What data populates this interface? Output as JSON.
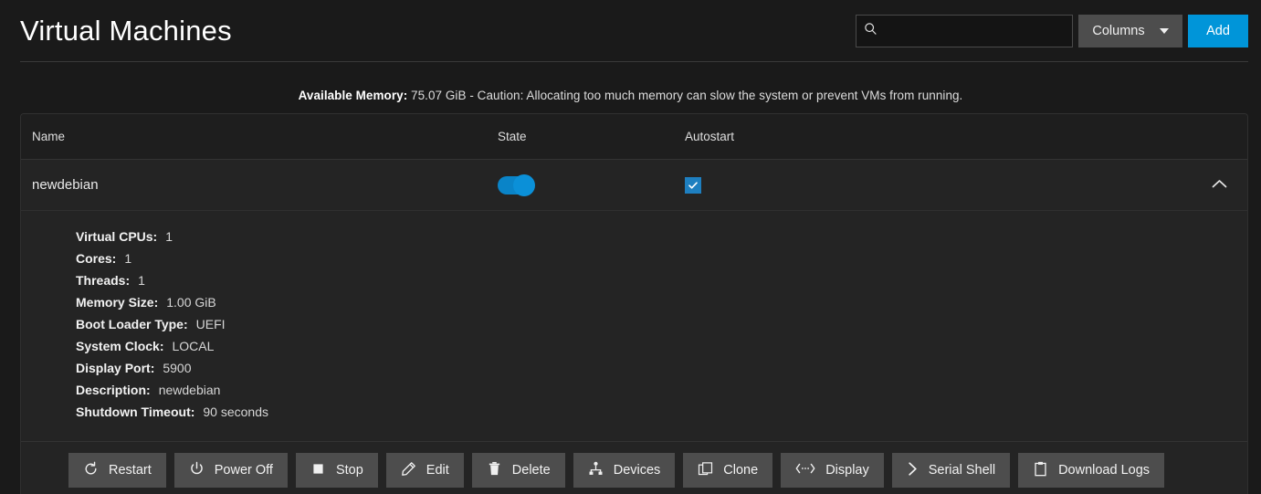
{
  "header": {
    "title": "Virtual Machines",
    "search": {
      "value": "",
      "placeholder": "",
      "icon": "search-icon"
    },
    "columns_button": {
      "label": "Columns",
      "icon": "chevron-down-icon"
    },
    "add_button": {
      "label": "Add"
    },
    "accent_color": "#0095d9"
  },
  "notice": {
    "label": "Available Memory:",
    "text": " 75.07 GiB - Caution: Allocating too much memory can slow the system or prevent VMs from running."
  },
  "table": {
    "columns": [
      "Name",
      "State",
      "Autostart"
    ],
    "row": {
      "name": "newdebian",
      "state_on": true,
      "autostart_checked": true,
      "expand_icon": "chevron-up-icon"
    }
  },
  "details": [
    {
      "label": "Virtual CPUs:",
      "value": "1"
    },
    {
      "label": "Cores:",
      "value": "1"
    },
    {
      "label": "Threads:",
      "value": "1"
    },
    {
      "label": "Memory Size:",
      "value": "1.00 GiB"
    },
    {
      "label": "Boot Loader Type:",
      "value": "UEFI"
    },
    {
      "label": "System Clock:",
      "value": "LOCAL"
    },
    {
      "label": "Display Port:",
      "value": "5900"
    },
    {
      "label": "Description:",
      "value": "newdebian"
    },
    {
      "label": "Shutdown Timeout:",
      "value": "90 seconds"
    }
  ],
  "actions": [
    {
      "label": "Restart",
      "icon": "restart-icon"
    },
    {
      "label": "Power Off",
      "icon": "power-icon"
    },
    {
      "label": "Stop",
      "icon": "stop-icon"
    },
    {
      "label": "Edit",
      "icon": "pencil-icon"
    },
    {
      "label": "Delete",
      "icon": "trash-icon"
    },
    {
      "label": "Devices",
      "icon": "devices-hub-icon"
    },
    {
      "label": "Clone",
      "icon": "copy-icon"
    },
    {
      "label": "Display",
      "icon": "code-arrows-icon"
    },
    {
      "label": "Serial Shell",
      "icon": "chevron-right-icon"
    },
    {
      "label": "Download Logs",
      "icon": "clipboard-icon"
    }
  ]
}
